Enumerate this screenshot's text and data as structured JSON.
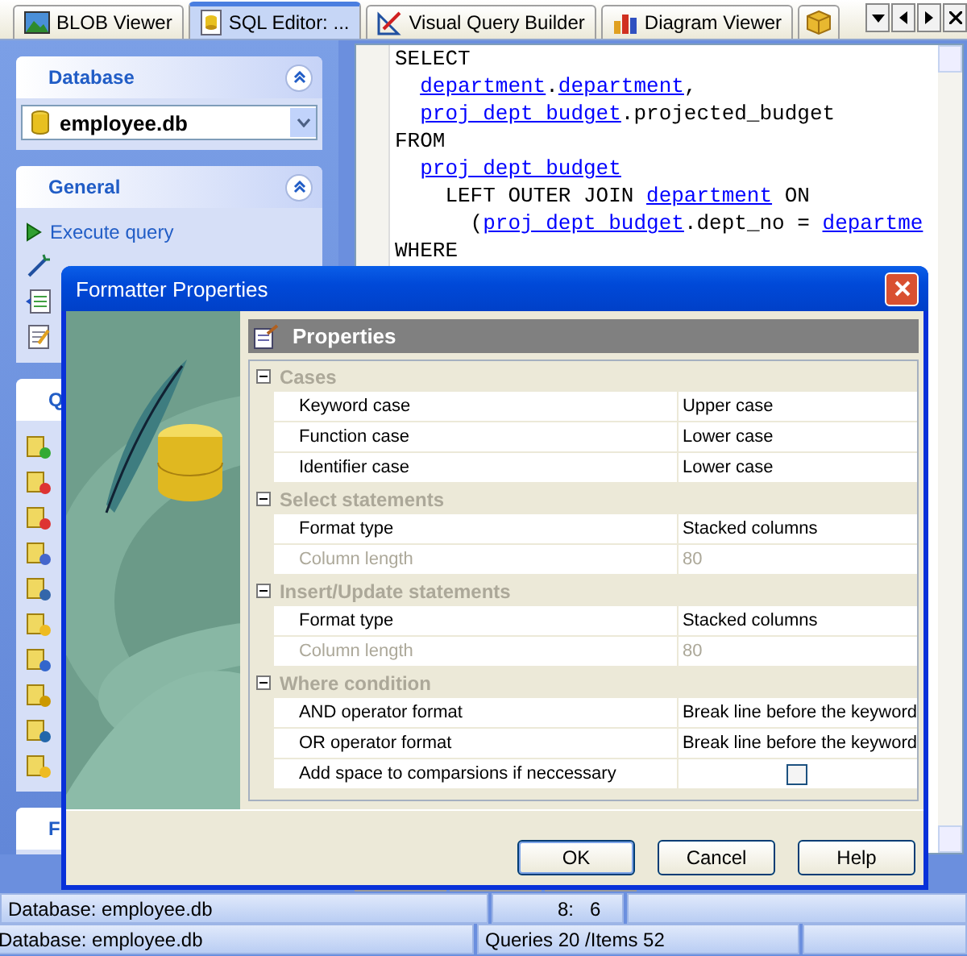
{
  "tabs": [
    {
      "label": "BLOB Viewer",
      "selected": false
    },
    {
      "label": "SQL Editor: ...",
      "selected": true
    },
    {
      "label": "Visual Query Builder",
      "selected": false
    },
    {
      "label": "Diagram Viewer",
      "selected": false
    }
  ],
  "sidebar": {
    "database": {
      "title": "Database",
      "value": "employee.db"
    },
    "general": {
      "title": "General",
      "items": [
        {
          "label": "Execute query"
        }
      ]
    },
    "queries": {
      "title": "Q"
    },
    "footer": {
      "title": "F"
    }
  },
  "editor": {
    "lines": [
      {
        "kind": "clause",
        "segments": [
          {
            "kind": "keyword",
            "text": "SELECT"
          }
        ]
      },
      {
        "kind": "item",
        "segments": [
          {
            "kind": "link",
            "text": "department"
          },
          {
            "kind": "plain",
            "text": "."
          },
          {
            "kind": "link",
            "text": "department"
          },
          {
            "kind": "plain",
            "text": ","
          }
        ]
      },
      {
        "kind": "item",
        "segments": [
          {
            "kind": "link",
            "text": "proj dept budget"
          },
          {
            "kind": "plain",
            "text": ".projected_budget"
          }
        ]
      },
      {
        "kind": "clause",
        "segments": [
          {
            "kind": "keyword",
            "text": "FROM"
          }
        ]
      },
      {
        "kind": "item",
        "segments": [
          {
            "kind": "link",
            "text": "proj dept budget"
          }
        ]
      },
      {
        "kind": "join",
        "segments": [
          {
            "kind": "keyword",
            "text": "LEFT OUTER JOIN "
          },
          {
            "kind": "link",
            "text": "department"
          },
          {
            "kind": "keyword",
            "text": " ON"
          }
        ]
      },
      {
        "kind": "condition",
        "segments": [
          {
            "kind": "plain",
            "text": "("
          },
          {
            "kind": "link",
            "text": "proj dept budget"
          },
          {
            "kind": "plain",
            "text": ".dept_no = "
          },
          {
            "kind": "link",
            "text": "departme"
          }
        ]
      },
      {
        "kind": "clause",
        "segments": [
          {
            "kind": "keyword",
            "text": "WHERE"
          }
        ]
      }
    ]
  },
  "dialog": {
    "title": "Formatter Properties",
    "header": "Properties",
    "groups": [
      {
        "title": "Cases",
        "expanded": true,
        "rows": [
          {
            "kind": "text",
            "name": "Keyword case",
            "value": "Upper case",
            "disabled": false
          },
          {
            "kind": "text",
            "name": "Function case",
            "value": "Lower case",
            "disabled": false
          },
          {
            "kind": "text",
            "name": "Identifier case",
            "value": "Lower case",
            "disabled": false
          }
        ]
      },
      {
        "title": "Select statements",
        "expanded": true,
        "rows": [
          {
            "kind": "text",
            "name": "Format type",
            "value": "Stacked columns",
            "disabled": false
          },
          {
            "kind": "text",
            "name": "Column length",
            "value": "80",
            "disabled": true
          }
        ]
      },
      {
        "title": "Insert/Update statements",
        "expanded": true,
        "rows": [
          {
            "kind": "text",
            "name": "Format type",
            "value": "Stacked columns",
            "disabled": false
          },
          {
            "kind": "text",
            "name": "Column length",
            "value": "80",
            "disabled": true
          }
        ]
      },
      {
        "title": "Where condition",
        "expanded": true,
        "rows": [
          {
            "kind": "text",
            "name": "AND operator format",
            "value": "Break line before the keyword",
            "disabled": false
          },
          {
            "kind": "text",
            "name": "OR operator format",
            "value": "Break line before the keyword",
            "disabled": false
          },
          {
            "kind": "checkbox",
            "name": "Add space to comparsions if neccessary",
            "checked": false,
            "disabled": false
          }
        ]
      }
    ],
    "buttons": [
      "OK",
      "Cancel",
      "Help"
    ]
  },
  "status_bar": {
    "row_1": [
      "Database: employee.db",
      "8:   6"
    ],
    "row_2": [
      "Database: employee.db",
      "Queries 20 /Items 52"
    ]
  }
}
